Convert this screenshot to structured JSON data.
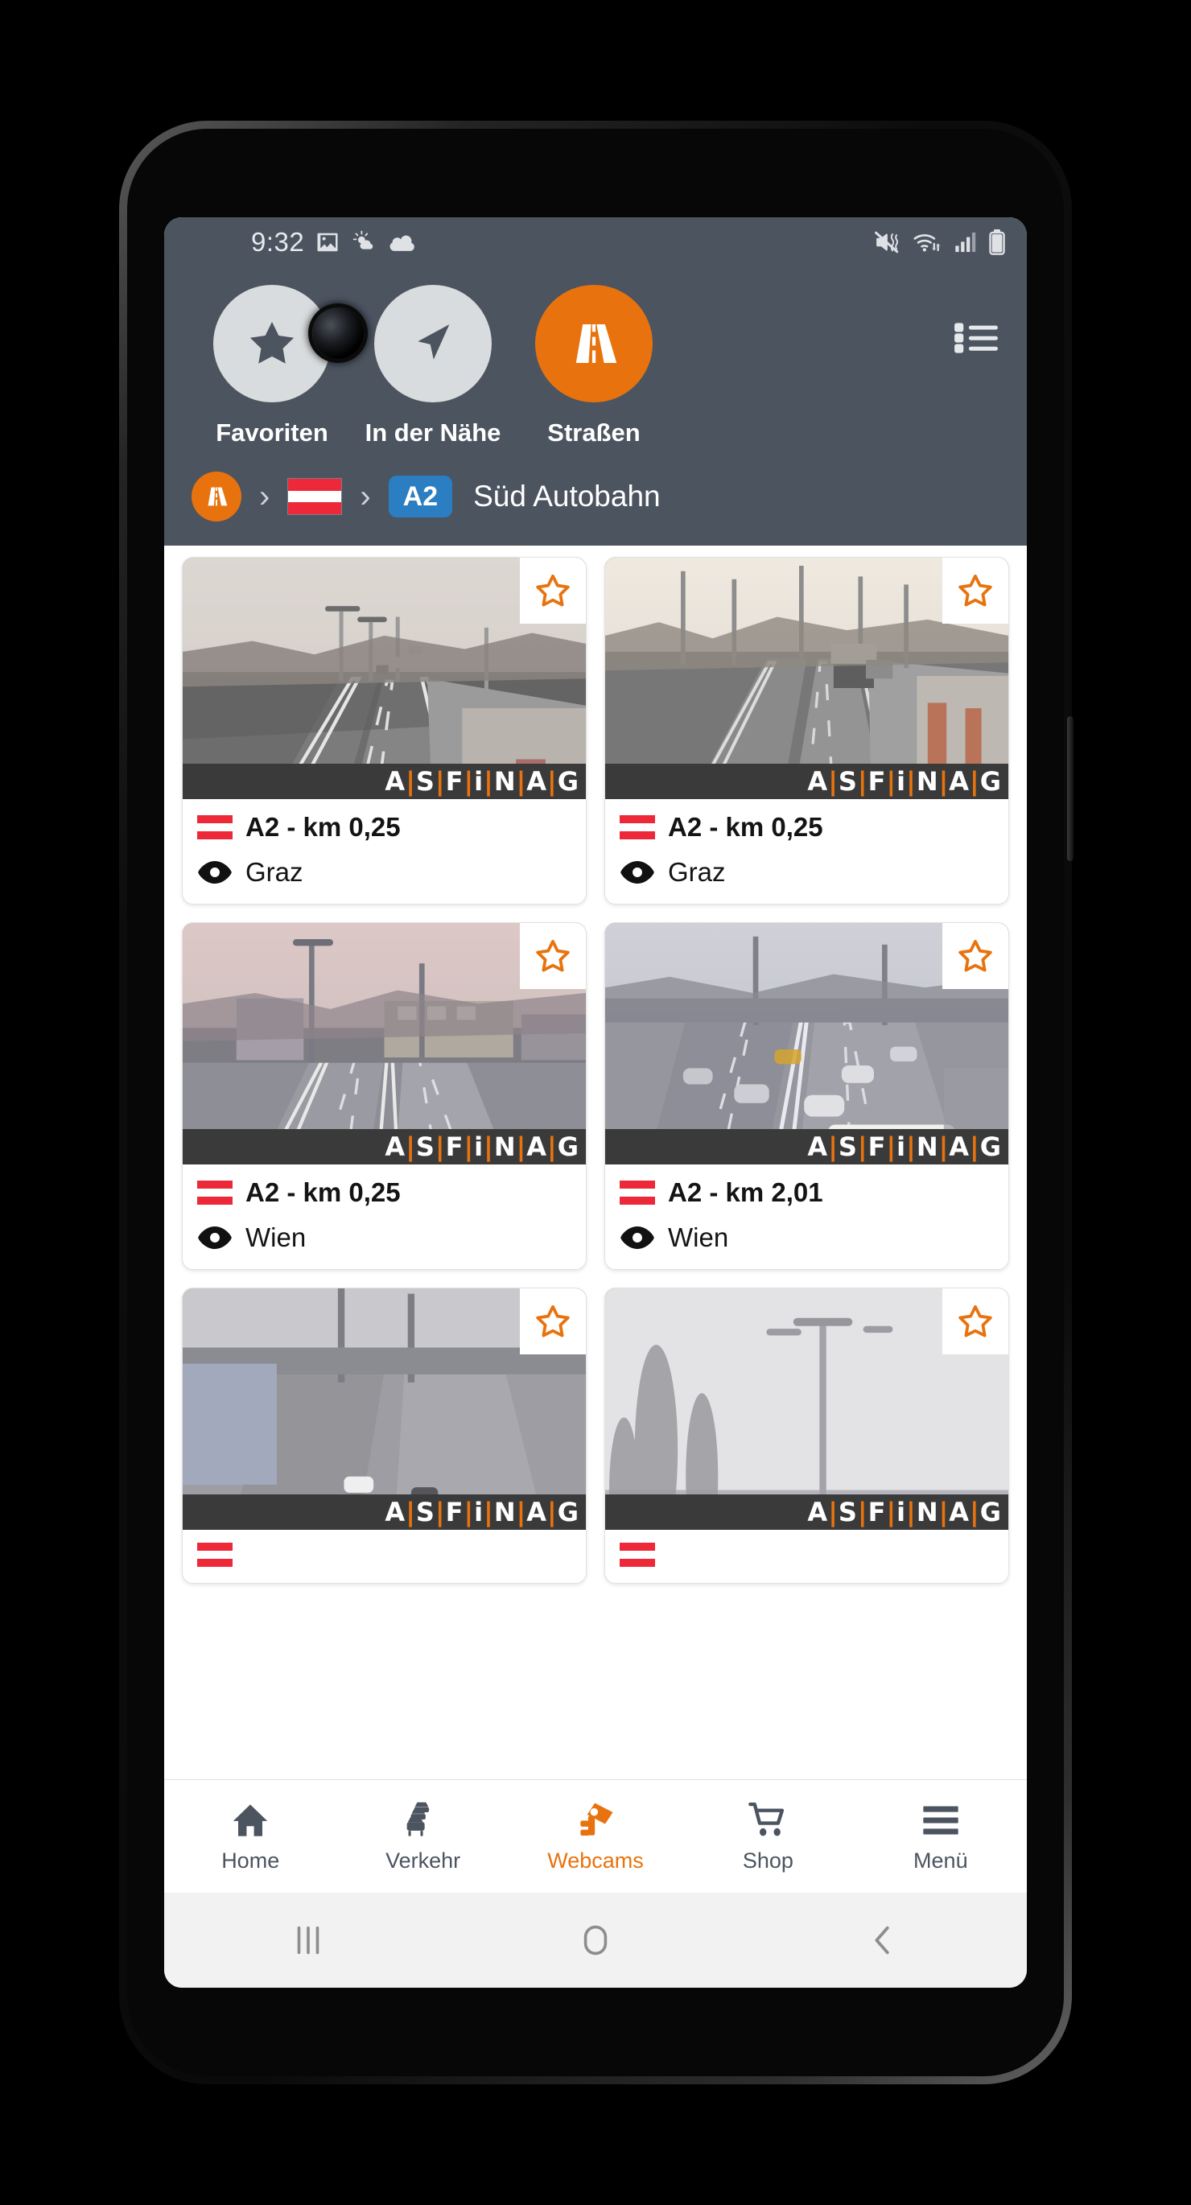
{
  "status_bar": {
    "clock": "9:32",
    "left_icons": [
      "image-icon",
      "weather-partly-sunny-icon",
      "cloud-icon"
    ],
    "right_icons": [
      "mute-vibrate-icon",
      "wifi-icon",
      "signal-bars-icon",
      "battery-icon"
    ]
  },
  "header": {
    "quick_nav": [
      {
        "label": "Favoriten",
        "icon": "star-icon",
        "active": false
      },
      {
        "label": "In der Nähe",
        "icon": "navigation-arrow-icon",
        "active": false
      },
      {
        "label": "Straßen",
        "icon": "highway-icon",
        "active": true
      }
    ],
    "list_toggle_icon": "list-view-icon",
    "colors": {
      "background": "#4c5460",
      "accent": "#e8730e",
      "circle": "#d9dcde"
    }
  },
  "breadcrumb": {
    "root_icon": "highway-icon",
    "separator": "›",
    "country_flag": "austria-flag",
    "road_badge": "A2",
    "road_badge_color": "#2b7ec1",
    "title": "Süd Autobahn"
  },
  "webcams": [
    {
      "flag": "austria-flag",
      "name": "A2 - km 0,25",
      "direction": "Graz",
      "watermark": "ASFINAG",
      "favorite": false,
      "scene": "highway-dusk-left"
    },
    {
      "flag": "austria-flag",
      "name": "A2 - km 0,25",
      "direction": "Graz",
      "watermark": "ASFINAG",
      "favorite": false,
      "scene": "highway-dusk-right"
    },
    {
      "flag": "austria-flag",
      "name": "A2 - km 0,25",
      "direction": "Wien",
      "watermark": "ASFINAG",
      "favorite": false,
      "scene": "highway-city-left"
    },
    {
      "flag": "austria-flag",
      "name": "A2 - km 2,01",
      "direction": "Wien",
      "watermark": "ASFINAG",
      "favorite": false,
      "scene": "highway-traffic-right"
    },
    {
      "flag": "austria-flag",
      "name": "",
      "direction": "",
      "watermark": "ASFINAG",
      "favorite": false,
      "scene": "highway-partial-left"
    },
    {
      "flag": "austria-flag",
      "name": "",
      "direction": "",
      "watermark": "ASFINAG",
      "favorite": false,
      "scene": "highway-partial-right"
    }
  ],
  "watermark_text": {
    "a1": "A",
    "s": "S",
    "f": "F",
    "i": "i",
    "n": "N",
    "a2": "A",
    "g": "G",
    "bar": "|"
  },
  "bottom_nav": [
    {
      "label": "Home",
      "icon": "home-icon",
      "active": false
    },
    {
      "label": "Verkehr",
      "icon": "traffic-cars-icon",
      "active": false
    },
    {
      "label": "Webcams",
      "icon": "webcam-icon",
      "active": true
    },
    {
      "label": "Shop",
      "icon": "shopping-cart-icon",
      "active": false
    },
    {
      "label": "Menü",
      "icon": "hamburger-menu-icon",
      "active": false
    }
  ],
  "android_nav": [
    {
      "icon": "recents-icon"
    },
    {
      "icon": "home-button-icon"
    },
    {
      "icon": "back-icon"
    }
  ]
}
